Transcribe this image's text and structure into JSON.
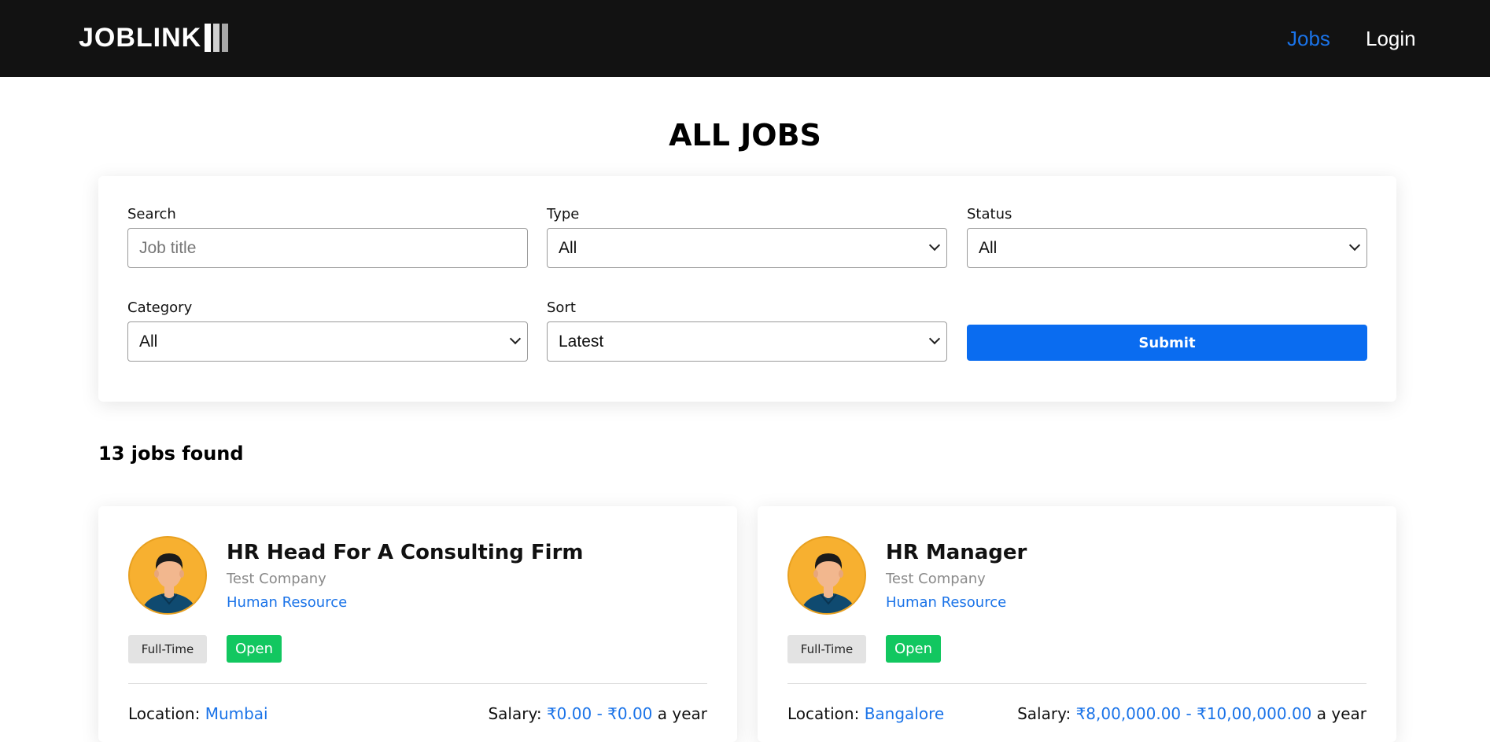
{
  "nav": {
    "brand": "JOBLINK",
    "links": [
      "Jobs",
      "Login"
    ],
    "active_color": "#1a73e8"
  },
  "page": {
    "title": "ALL JOBS"
  },
  "filters": {
    "search": {
      "label": "Search",
      "placeholder": "Job title"
    },
    "type": {
      "label": "Type",
      "value": "All"
    },
    "status": {
      "label": "Status",
      "value": "All"
    },
    "category": {
      "label": "Category",
      "value": "All"
    },
    "sort": {
      "label": "Sort",
      "value": "Latest"
    },
    "submit_label": "Submit"
  },
  "results": {
    "count_text": "13 jobs found"
  },
  "jobs": [
    {
      "title": "HR Head For A Consulting Firm",
      "company": "Test Company",
      "category": "Human Resource",
      "type": "Full-Time",
      "status": "Open",
      "location_label": "Location:",
      "location": "Mumbai",
      "salary_label": "Salary:",
      "salary": "₹0.00 - ₹0.00",
      "salary_period": "a year"
    },
    {
      "title": "HR Manager",
      "company": "Test Company",
      "category": "Human Resource",
      "type": "Full-Time",
      "status": "Open",
      "location_label": "Location:",
      "location": "Bangalore",
      "salary_label": "Salary:",
      "salary": "₹8,00,000.00 - ₹10,00,000.00",
      "salary_period": "a year"
    }
  ],
  "colors": {
    "navbar": "#121212",
    "primary_button": "#0a6cf0",
    "open_badge": "#12c760",
    "link": "#1a73e8"
  }
}
